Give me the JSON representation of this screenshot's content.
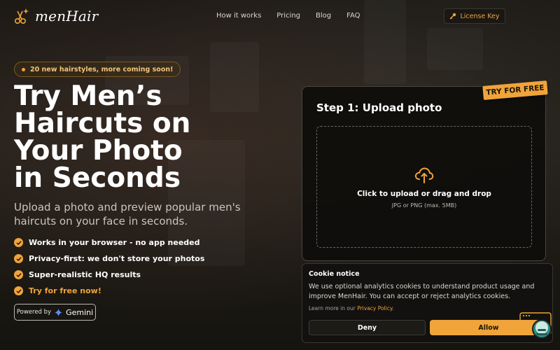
{
  "brand": {
    "name": "menHair",
    "accent": "#f0a43a"
  },
  "nav": {
    "links": [
      "How it works",
      "Pricing",
      "Blog",
      "FAQ"
    ],
    "license_label": "License Key"
  },
  "hero": {
    "badge": "20 new hairstyles, more coming soon!",
    "title_lines": [
      "Try Men’s",
      "Haircuts on",
      "Your Photo",
      "in Seconds"
    ],
    "subtitle": "Upload a photo and preview popular men's haircuts on your face in seconds.",
    "features": [
      "Works in your browser - no app needed",
      "Privacy-first: we don't store your photos",
      "Super-realistic HQ results",
      "Try for free now!"
    ],
    "powered_by": "Powered by",
    "powered_brand": "Gemini"
  },
  "upload": {
    "tag": "TRY FOR FREE",
    "title": "Step 1: Upload photo",
    "cta": "Click to upload or drag and drop",
    "hint": "JPG or PNG (max. 5MB)"
  },
  "cookie": {
    "title": "Cookie notice",
    "text": "We use optional analytics cookies to understand product usage and improve MenHair. You can accept or reject analytics cookies.",
    "learn_prefix": "Learn more in our",
    "policy_link": "Privacy Policy",
    "learn_suffix": ".",
    "deny": "Deny",
    "allow": "Allow"
  }
}
